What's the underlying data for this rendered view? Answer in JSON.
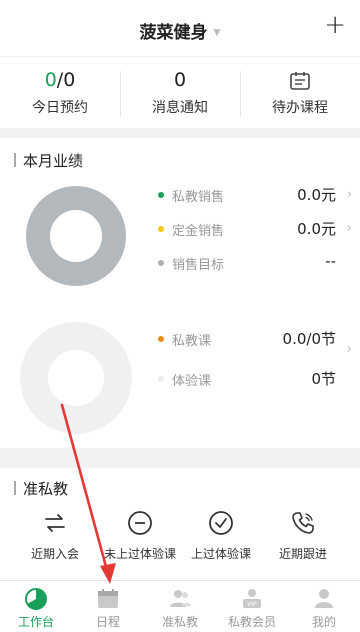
{
  "header": {
    "title": "菠菜健身",
    "add_label": "+"
  },
  "stats": {
    "appointments": {
      "done": "0",
      "total": "/0",
      "label": "今日预约"
    },
    "messages": {
      "value": "0",
      "label": "消息通知"
    },
    "pending": {
      "label": "待办课程"
    }
  },
  "performance": {
    "title": "本月业绩",
    "sales": [
      {
        "label": "私教销售",
        "value": "0.0元",
        "color": "#1aa05a"
      },
      {
        "label": "定金销售",
        "value": "0.0元",
        "color": "#f5c518"
      },
      {
        "label": "销售目标",
        "value": "--",
        "color": "#b0b0b0"
      }
    ],
    "courses": [
      {
        "label": "私教课",
        "value": "0.0/0节",
        "color": "#f08a1c"
      },
      {
        "label": "体验课",
        "value": "0节",
        "color": "#eeeeee"
      }
    ]
  },
  "private_section": {
    "title": "准私教",
    "actions": [
      {
        "label": "近期入会",
        "icon": "transfer-icon"
      },
      {
        "label": "未上过体验课",
        "icon": "minus-circle-icon"
      },
      {
        "label": "上过体验课",
        "icon": "check-circle-icon"
      },
      {
        "label": "近期跟进",
        "icon": "phone-icon"
      }
    ]
  },
  "tabs": [
    {
      "label": "工作台",
      "icon": "dashboard-icon",
      "active": true
    },
    {
      "label": "日程",
      "icon": "calendar-icon"
    },
    {
      "label": "准私教",
      "icon": "user-group-icon"
    },
    {
      "label": "私教会员",
      "icon": "member-card-icon"
    },
    {
      "label": "我的",
      "icon": "person-icon"
    }
  ],
  "colors": {
    "accent": "#1aa05a",
    "annotation_arrow": "#e53935"
  }
}
